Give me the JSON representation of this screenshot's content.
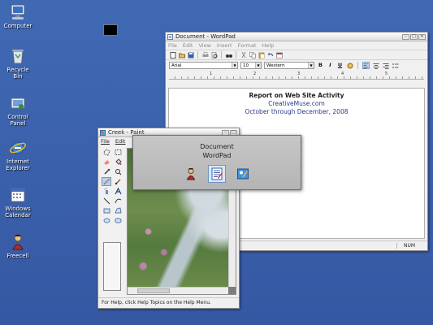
{
  "desktop": {
    "icons": [
      {
        "label": "Computer",
        "icon": "computer-icon"
      },
      {
        "label": "Recycle Bin",
        "icon": "recycle-bin-icon"
      },
      {
        "label": "Control Panel",
        "icon": "control-panel-icon"
      },
      {
        "label": "Internet Explorer",
        "icon": "internet-explorer-icon"
      },
      {
        "label": "Windows Calendar",
        "icon": "calendar-icon"
      },
      {
        "label": "Freecell",
        "icon": "freecell-icon"
      }
    ],
    "background_color": "#3a5fa8"
  },
  "wordpad": {
    "title": "Document - WordPad",
    "menu": [
      "File",
      "Edit",
      "View",
      "Insert",
      "Format",
      "Help"
    ],
    "font_name": "Arial",
    "font_size": "10",
    "script": "Western",
    "format_buttons": [
      "B",
      "I",
      "U"
    ],
    "ruler_numbers": [
      "1",
      "2",
      "3",
      "4",
      "5"
    ],
    "document": {
      "heading": "Report on Web Site Activity",
      "line2": "CreativeMuse.com",
      "line3": "October through December, 2008"
    },
    "status": "NUM"
  },
  "paint": {
    "title": "Creek - Paint",
    "menu": [
      "File",
      "Edit"
    ],
    "status": "For Help, click Help Topics on the Help Menu."
  },
  "switcher": {
    "title_line1": "Document",
    "title_line2": "WordPad",
    "items": [
      "freecell-icon",
      "wordpad-icon",
      "paint-icon"
    ],
    "selected_index": 1
  }
}
